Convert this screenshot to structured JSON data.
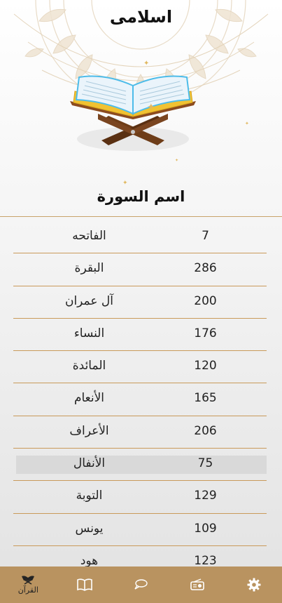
{
  "app": {
    "title": "اسلامى"
  },
  "list_header": {
    "column_title": "اسم السورة"
  },
  "surahs": [
    {
      "name": "الفاتحه",
      "verses": "7"
    },
    {
      "name": "البقرة",
      "verses": "286"
    },
    {
      "name": "آل عمران",
      "verses": "200"
    },
    {
      "name": "النساء",
      "verses": "176"
    },
    {
      "name": "المائدة",
      "verses": "120"
    },
    {
      "name": "الأنعام",
      "verses": "165"
    },
    {
      "name": "الأعراف",
      "verses": "206"
    },
    {
      "name": "الأنفال",
      "verses": "75"
    },
    {
      "name": "التوبة",
      "verses": "129"
    },
    {
      "name": "يونس",
      "verses": "109"
    },
    {
      "name": "هود",
      "verses": "123"
    }
  ],
  "bottom_nav": {
    "quran_label": "القرآن",
    "items": [
      "quran-icon",
      "book-icon",
      "chat-bubble-icon",
      "radio-icon",
      "gear-icon"
    ]
  },
  "colors": {
    "nav_bg": "#b99360",
    "divider": "#c99a5a",
    "highlight_row": "#d9d9d9"
  }
}
